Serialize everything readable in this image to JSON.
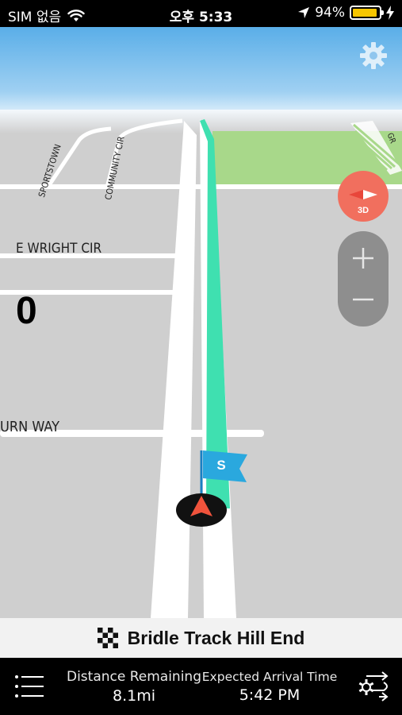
{
  "status_bar": {
    "carrier": "SIM 없음",
    "time": "오후 5:33",
    "battery_percent": "94%",
    "battery_level": 0.94,
    "battery_color": "#f7c600"
  },
  "map": {
    "colors": {
      "sky": "#6cb6ea",
      "ground": "#cfcfcf",
      "park": "#a8d88a",
      "road": "#ffffff",
      "route": "#3fe0b0",
      "compass": "#f16f5e",
      "start_flag": "#2aa8de"
    },
    "road_labels": {
      "sportstown": "SPORTSTOWN",
      "community_cir": "COMMUNITY CIR",
      "e_wright_cir": "E WRIGHT CIR",
      "urn_way": "URN WAY",
      "corner": "GR"
    },
    "speed": "0",
    "start_flag_label": "S",
    "compass_mode": "3D",
    "zoom_in": "+",
    "zoom_out": "−"
  },
  "destination": {
    "name": "Bridle Track Hill End",
    "icon": "checkered-flag-icon"
  },
  "bottom_bar": {
    "distance_label": "Distance Remaining",
    "distance_value": "8.1mi",
    "eta_label": "Expected Arrival Time",
    "eta_value": "5:42 PM",
    "menu_icon": "menu-list-icon",
    "route_settings_icon": "route-settings-icon"
  }
}
